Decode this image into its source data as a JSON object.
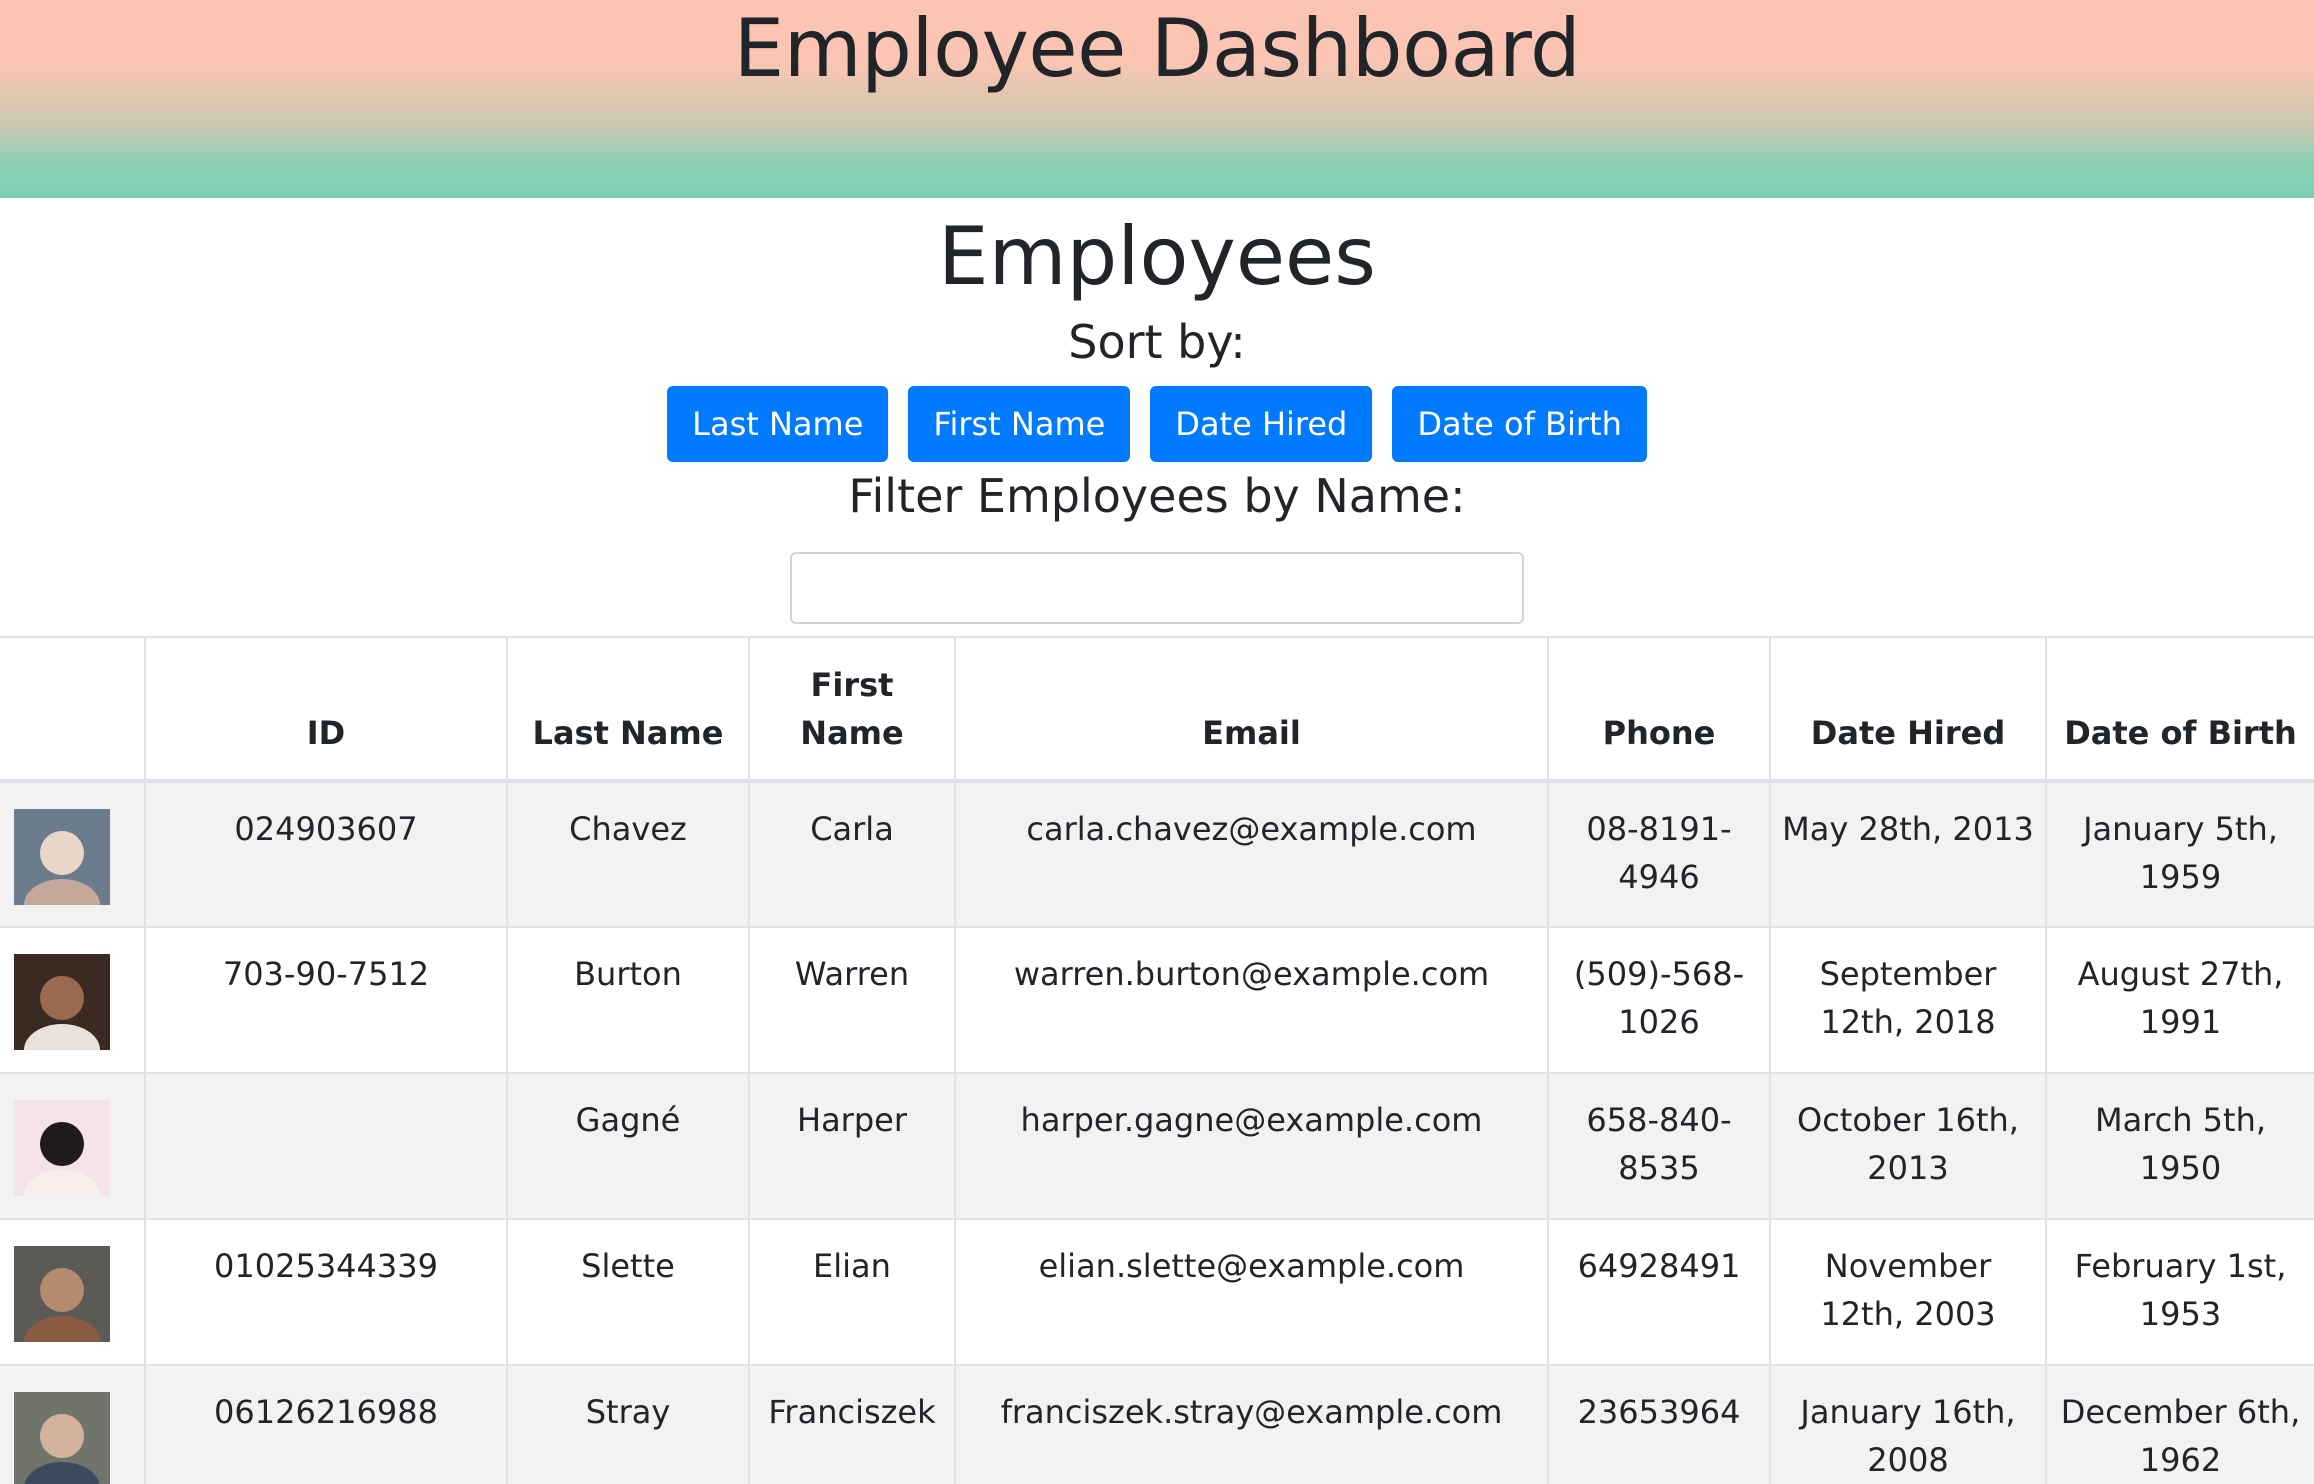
{
  "header": {
    "title": "Employee Dashboard"
  },
  "main": {
    "title": "Employees",
    "sort_label": "Sort by:",
    "sort_buttons": [
      "Last Name",
      "First Name",
      "Date Hired",
      "Date of Birth"
    ],
    "filter_label": "Filter Employees by Name:",
    "filter_value": "",
    "filter_placeholder": ""
  },
  "table": {
    "columns": [
      "",
      "ID",
      "Last Name",
      "First Name",
      "Email",
      "Phone",
      "Date Hired",
      "Date of Birth"
    ],
    "rows": [
      {
        "id": "024903607",
        "last": "Chavez",
        "first": "Carla",
        "email": "carla.chavez@example.com",
        "phone": "08-8191-4946",
        "hired": "May 28th, 2013",
        "dob": "January 5th, 1959",
        "avatar_colors": [
          "#6b7d8c",
          "#e9d6c8",
          "#c4a99a"
        ]
      },
      {
        "id": "703-90-7512",
        "last": "Burton",
        "first": "Warren",
        "email": "warren.burton@example.com",
        "phone": "(509)-568-1026",
        "hired": "September 12th, 2018",
        "dob": "August 27th, 1991",
        "avatar_colors": [
          "#3b2a22",
          "#9a6a4e",
          "#e8e2da"
        ]
      },
      {
        "id": "",
        "last": "Gagné",
        "first": "Harper",
        "email": "harper.gagne@example.com",
        "phone": "658-840-8535",
        "hired": "October 16th, 2013",
        "dob": "March 5th, 1950",
        "avatar_colors": [
          "#f4e4e8",
          "#1f1b1c",
          "#f7eeee"
        ]
      },
      {
        "id": "01025344339",
        "last": "Slette",
        "first": "Elian",
        "email": "elian.slette@example.com",
        "phone": "64928491",
        "hired": "November 12th, 2003",
        "dob": "February 1st, 1953",
        "avatar_colors": [
          "#5c5a56",
          "#b58a6e",
          "#8b5c44"
        ]
      },
      {
        "id": "06126216988",
        "last": "Stray",
        "first": "Franciszek",
        "email": "franciszek.stray@example.com",
        "phone": "23653964",
        "hired": "January 16th, 2008",
        "dob": "December 6th, 1962",
        "avatar_colors": [
          "#70746a",
          "#d3b39c",
          "#3b4a5c"
        ]
      }
    ]
  }
}
